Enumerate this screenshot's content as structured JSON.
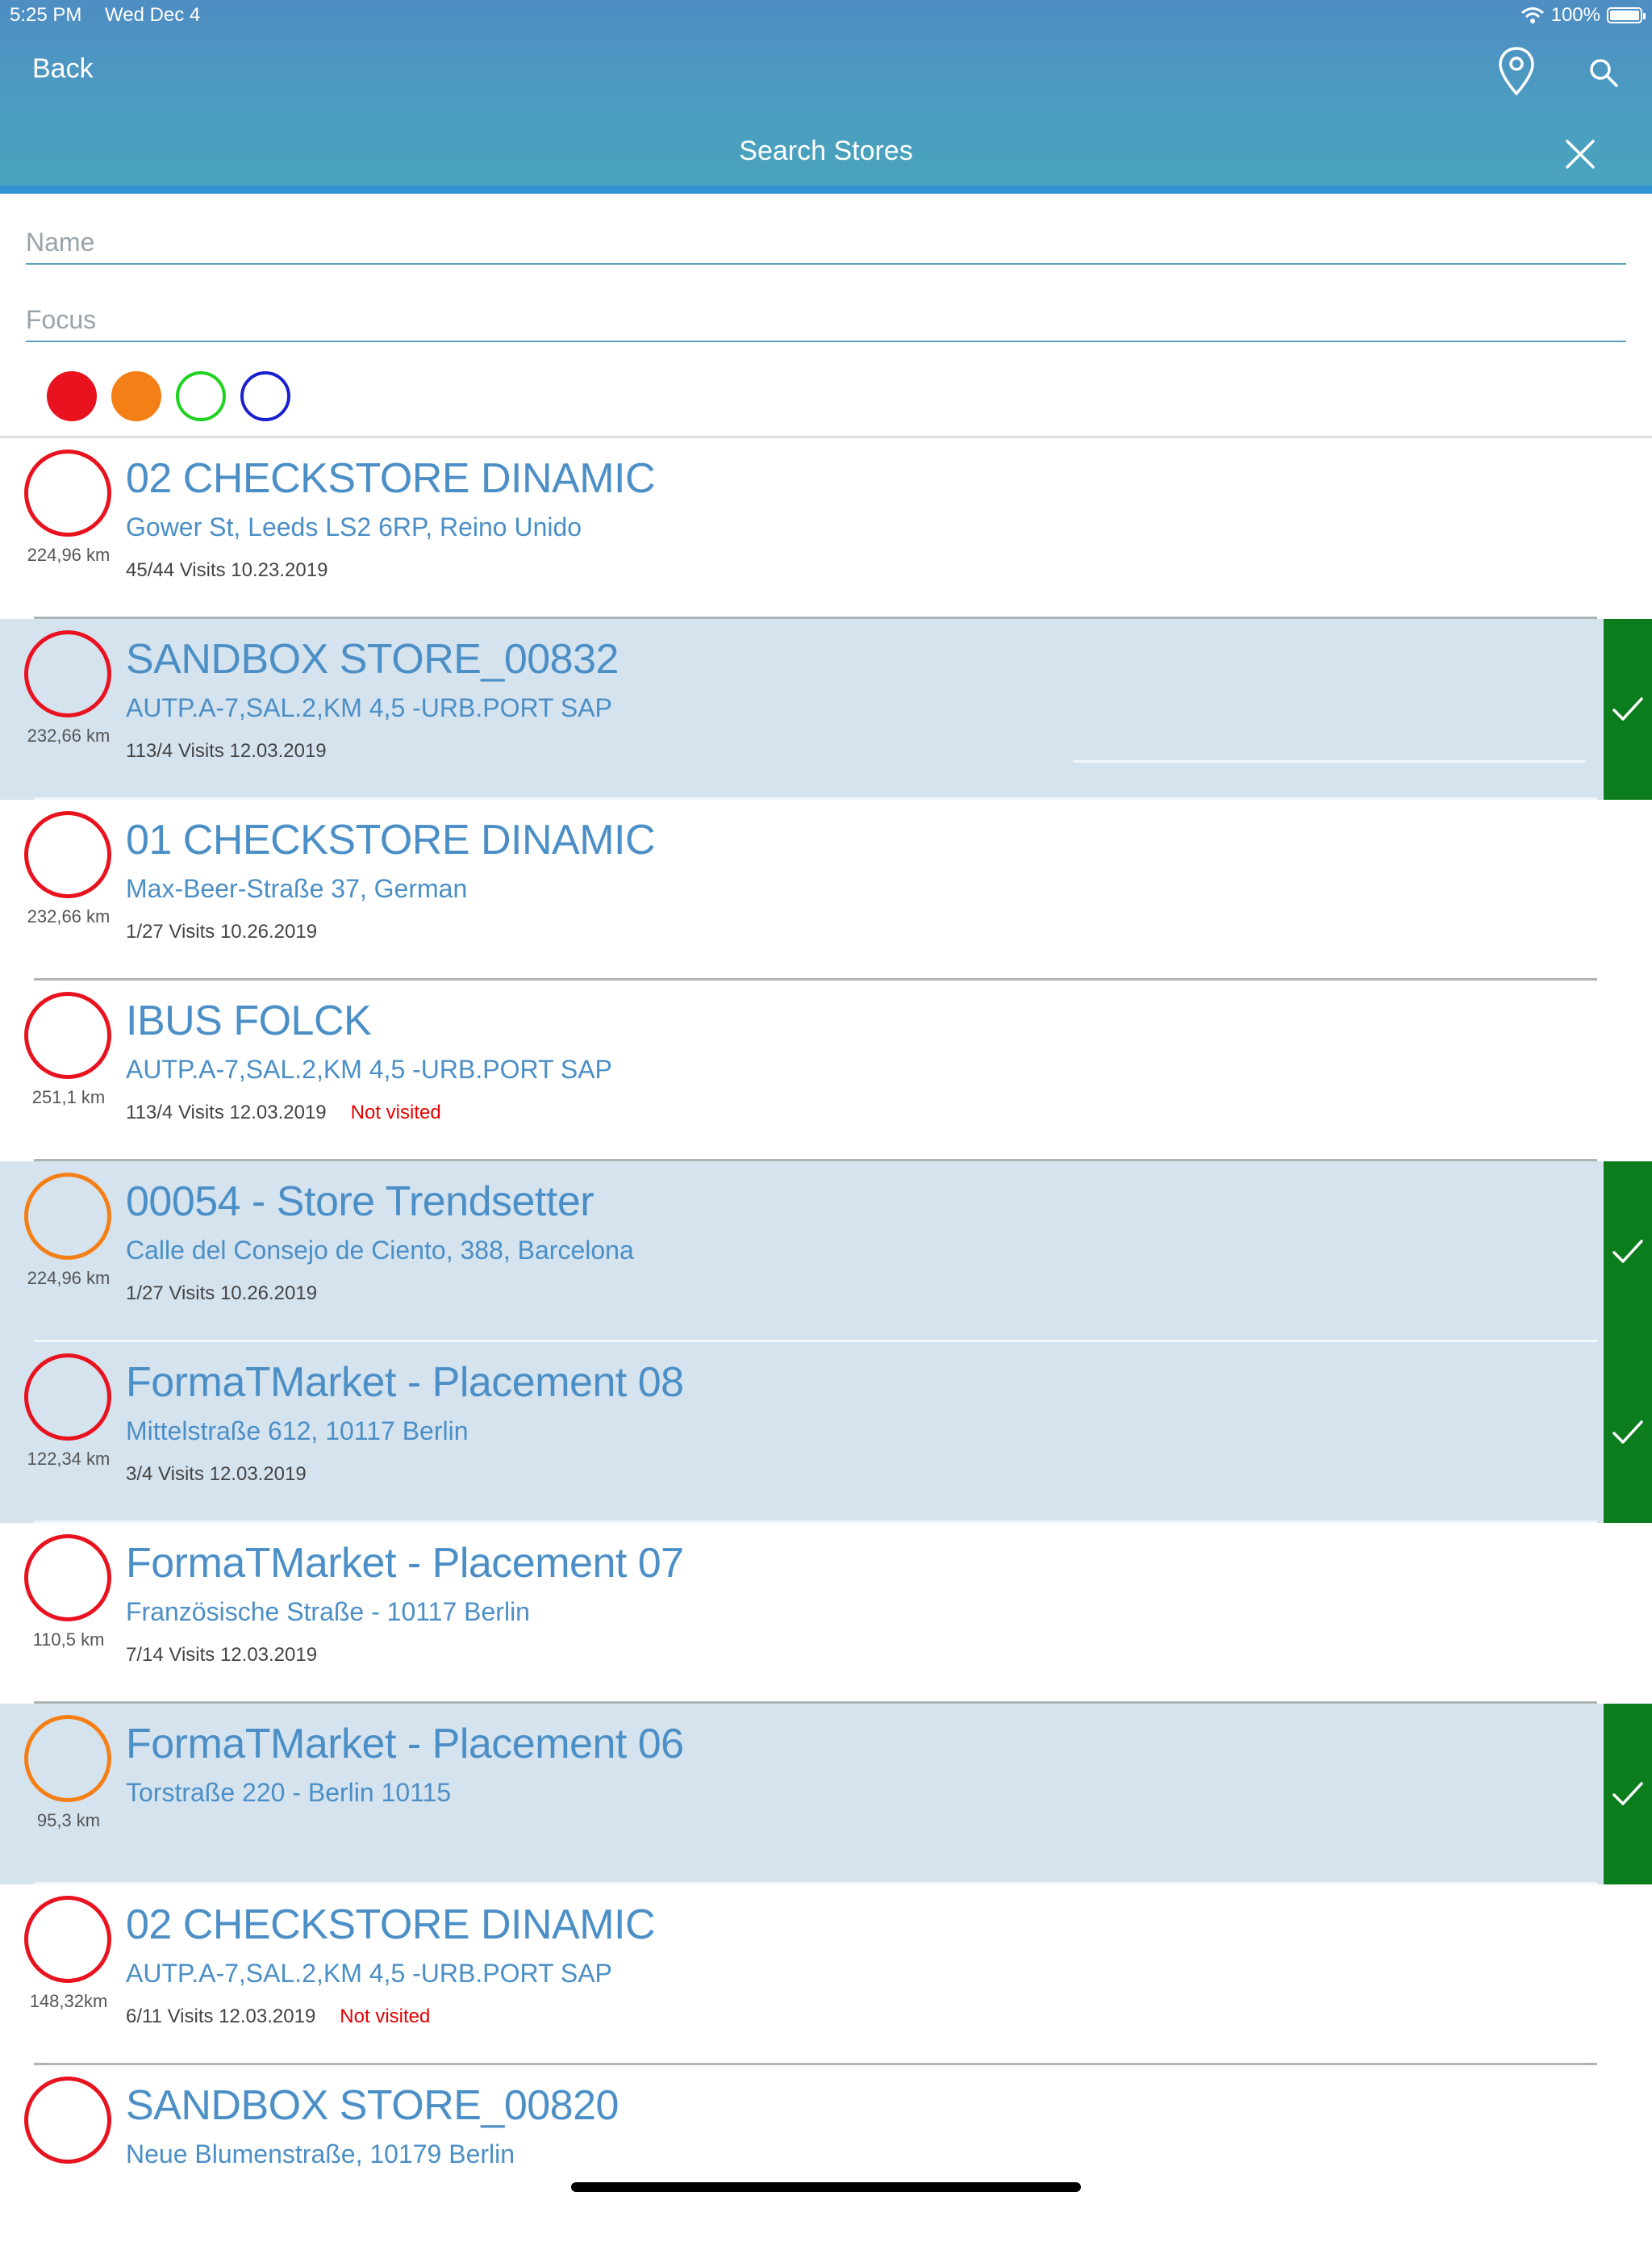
{
  "status": {
    "time": "5:25 PM",
    "date": "Wed Dec 4",
    "battery": "100%",
    "battery_level": 1.0
  },
  "header": {
    "back_label": "Back",
    "title": "Search Stores"
  },
  "form": {
    "name_placeholder": "Name",
    "focus_placeholder": "Focus"
  },
  "colors": {
    "red": "#e8131f",
    "orange": "#f57f17",
    "green": "#1ed21e",
    "blue": "#1a1fd0",
    "check_green": "#0b7d1d",
    "link_blue": "#4b8fc6",
    "not_visited": "#e60000"
  },
  "focus_filters": [
    {
      "name": "red",
      "filled": true
    },
    {
      "name": "orange",
      "filled": true
    },
    {
      "name": "green",
      "filled": false
    },
    {
      "name": "blue",
      "filled": false
    }
  ],
  "stores": [
    {
      "name": "02 CHECKSTORE DINAMIC",
      "address": "Gower St, Leeds LS2 6RP, Reino Unido",
      "visits": "45/44 Visits 10.23.2019",
      "distance": "224,96 km",
      "ring": "red",
      "selected": false,
      "status": ""
    },
    {
      "name": "SANDBOX STORE_00832",
      "address": "AUTP.A-7,SAL.2,KM 4,5 -URB.PORT SAP",
      "visits": "113/4 Visits 12.03.2019",
      "distance": "232,66 km",
      "ring": "red",
      "selected": true,
      "status": ""
    },
    {
      "name": "01 CHECKSTORE DINAMIC",
      "address": "Max-Beer-Straße 37, German",
      "visits": "1/27 Visits 10.26.2019",
      "distance": "232,66 km",
      "ring": "red",
      "selected": false,
      "status": ""
    },
    {
      "name": "IBUS FOLCK",
      "address": "AUTP.A-7,SAL.2,KM 4,5 -URB.PORT SAP",
      "visits": "113/4 Visits 12.03.2019",
      "distance": "251,1 km",
      "ring": "red",
      "selected": false,
      "status": "Not visited"
    },
    {
      "name": "00054 - Store Trendsetter",
      "address": "Calle del Consejo de Ciento, 388, Barcelona",
      "visits": "1/27 Visits 10.26.2019",
      "distance": "224,96 km",
      "ring": "orange",
      "selected": true,
      "status": ""
    },
    {
      "name": "FormaTMarket - Placement 08",
      "address": "Mittelstraße 612, 10117 Berlin",
      "visits": "3/4 Visits 12.03.2019",
      "distance": "122,34 km",
      "ring": "red",
      "selected": true,
      "status": ""
    },
    {
      "name": "FormaTMarket - Placement 07",
      "address": "Französische Straße - 10117 Berlin",
      "visits": "7/14 Visits 12.03.2019",
      "distance": "110,5 km",
      "ring": "red",
      "selected": false,
      "status": ""
    },
    {
      "name": "FormaTMarket - Placement 06",
      "address": "Torstraße 220 - Berlin 10115",
      "visits": "",
      "distance": "95,3 km",
      "ring": "orange",
      "selected": true,
      "status": ""
    },
    {
      "name": "02 CHECKSTORE DINAMIC",
      "address": "AUTP.A-7,SAL.2,KM 4,5 -URB.PORT SAP",
      "visits": "6/11 Visits 12.03.2019",
      "distance": "148,32km",
      "ring": "red",
      "selected": false,
      "status": "Not visited"
    },
    {
      "name": "SANDBOX STORE_00820",
      "address": "Neue Blumenstraße,  10179 Berlin",
      "visits": "",
      "distance": "",
      "ring": "red",
      "selected": false,
      "status": ""
    }
  ]
}
